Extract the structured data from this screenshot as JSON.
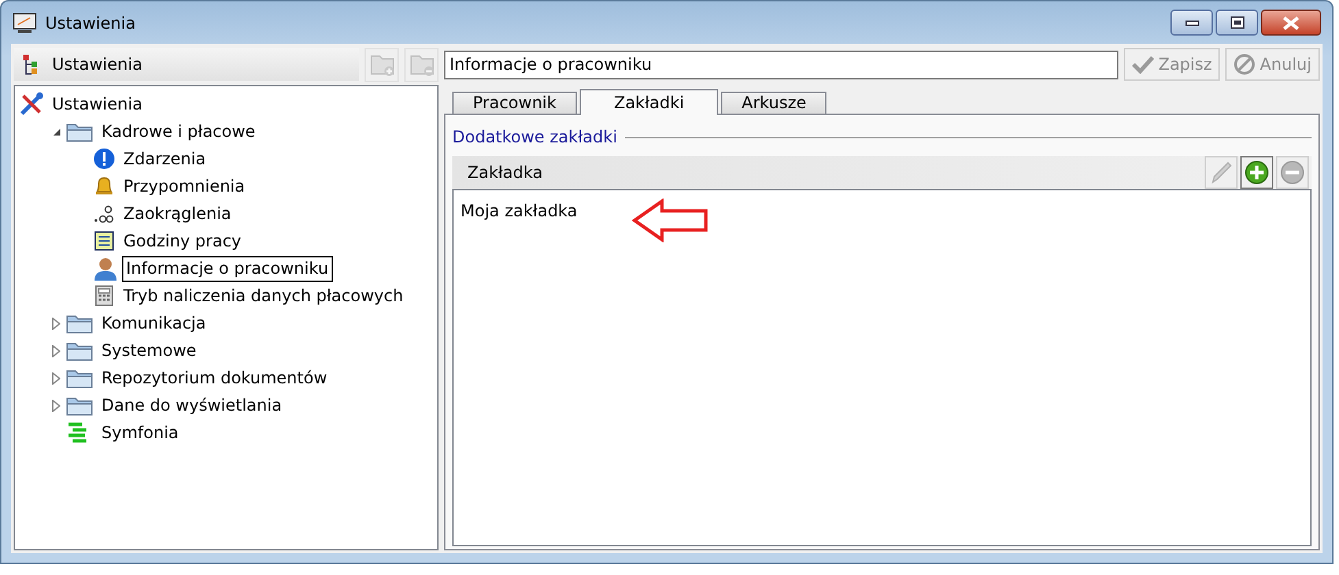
{
  "window": {
    "title": "Ustawienia"
  },
  "left_panel": {
    "header": "Ustawienia",
    "buttons": [
      {
        "kind": "add-folder",
        "disabled": true
      },
      {
        "kind": "remove-folder",
        "disabled": true
      }
    ]
  },
  "tree": [
    {
      "label": "Ustawienia",
      "kind": "settings",
      "selected": false,
      "children": [
        {
          "label": "Kadrowe i płacowe",
          "kind": "folder",
          "expanded": true,
          "selected": false,
          "children": [
            {
              "label": "Zdarzenia",
              "kind": "info",
              "selected": false
            },
            {
              "label": "Przypomnienia",
              "kind": "bell",
              "selected": false
            },
            {
              "label": "Zaokrąglenia",
              "kind": "rounding",
              "selected": false
            },
            {
              "label": "Godziny pracy",
              "kind": "sheet",
              "selected": false
            },
            {
              "label": "Informacje o pracowniku",
              "kind": "person",
              "selected": true
            },
            {
              "label": "Tryb naliczenia danych płacowych",
              "kind": "calculator",
              "selected": false
            }
          ]
        },
        {
          "label": "Komunikacja",
          "kind": "folder",
          "expanded": false,
          "selected": false
        },
        {
          "label": "Systemowe",
          "kind": "folder",
          "expanded": false,
          "selected": false
        },
        {
          "label": "Repozytorium dokumentów",
          "kind": "folder",
          "expanded": false,
          "selected": false
        },
        {
          "label": "Dane do wyświetlania",
          "kind": "folder",
          "expanded": false,
          "selected": false
        },
        {
          "label": "Symfonia",
          "kind": "symfonia",
          "selected": false
        }
      ]
    }
  ],
  "title_field": {
    "value": "Informacje o pracowniku"
  },
  "actions": [
    {
      "label": "Zapisz",
      "kind": "save",
      "disabled": true
    },
    {
      "label": "Anuluj",
      "kind": "cancel",
      "disabled": true
    }
  ],
  "tabs": [
    {
      "label": "Pracownik",
      "selected": false
    },
    {
      "label": "Zakładki",
      "selected": true
    },
    {
      "label": "Arkusze",
      "selected": false
    }
  ],
  "group": {
    "title": "Dodatkowe zakładki"
  },
  "list": {
    "header": "Zakładka",
    "tools": [
      {
        "kind": "edit",
        "disabled": true
      },
      {
        "kind": "add",
        "disabled": false
      },
      {
        "kind": "remove",
        "disabled": true
      }
    ],
    "rows": [
      "Moja zakładka"
    ]
  }
}
